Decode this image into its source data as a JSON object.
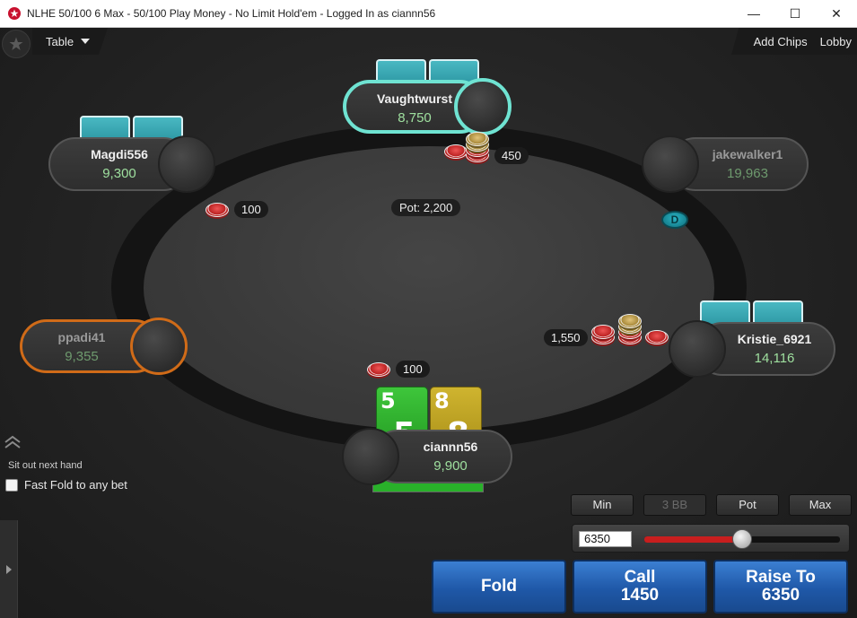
{
  "window": {
    "title": "NLHE 50/100 6 Max - 50/100 Play Money - No Limit Hold'em - Logged In as ciannn56",
    "minimize": "—",
    "maximize": "☐",
    "close": "✕",
    "accent": "#c8102e"
  },
  "menu": {
    "table": "Table",
    "add_chips": "Add Chips",
    "lobby": "Lobby"
  },
  "seats": {
    "vaughtwurst": {
      "name": "Vaughtwurst",
      "stack": "8,750",
      "bet": "450"
    },
    "magdi": {
      "name": "Magdi556",
      "stack": "9,300",
      "bet": "100"
    },
    "jakewalker": {
      "name": "jakewalker1",
      "stack": "19,963"
    },
    "kristie": {
      "name": "Kristie_6921",
      "stack": "14,116",
      "bet": "1,550"
    },
    "ppadi": {
      "name": "ppadi41",
      "stack": "9,355"
    },
    "hero": {
      "name": "ciannn56",
      "stack": "9,900",
      "bet": "100",
      "time_bank": 1.0
    }
  },
  "pot": "Pot: 2,200",
  "dealer_button": "D",
  "hero_cards": [
    {
      "rank": "5",
      "color": "green"
    },
    {
      "rank": "8",
      "color": "yellow"
    }
  ],
  "controls": {
    "sit_out": "Sit out next hand",
    "fast_fold": "Fast Fold to any bet",
    "presets": {
      "min": "Min",
      "bb3": "3 BB",
      "pot": "Pot",
      "max": "Max"
    },
    "bet_value": "6350",
    "slider_level": 0.5
  },
  "actions": {
    "fold": "Fold",
    "call_label": "Call",
    "call_amount": "1450",
    "raise_label": "Raise To",
    "raise_amount": "6350"
  }
}
